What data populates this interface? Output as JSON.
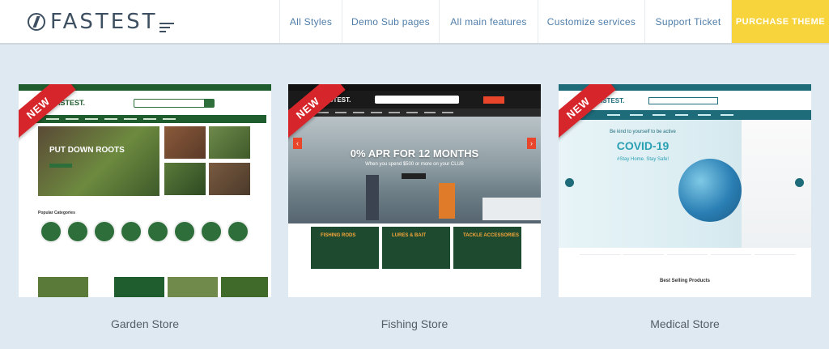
{
  "header": {
    "logo_text": "FASTEST",
    "menu": [
      {
        "label": "All Styles"
      },
      {
        "label": "Demo Sub pages"
      },
      {
        "label": "All main features"
      },
      {
        "label": "Customize services"
      },
      {
        "label": "Support Ticket"
      },
      {
        "label": "PURCHASE THEME"
      }
    ],
    "accent_color": "#f7d43b",
    "link_color": "#4f7da8"
  },
  "demos": [
    {
      "label": "Garden Store",
      "badge": "NEW",
      "preview": {
        "logo": "FASTEST.",
        "hero_title": "PUT DOWN ROOTS",
        "popular_heading": "Popular Categories"
      }
    },
    {
      "label": "Fishing Store",
      "badge": "NEW",
      "preview": {
        "logo": "FASTEST.",
        "hero_title": "0% APR FOR 12 MONTHS",
        "hero_subtitle": "When you spend $500 or more on your CLUB",
        "promo_1": "FISHING RODS",
        "promo_2": "LURES & BAIT",
        "promo_3": "TACKLE ACCESSORIES"
      }
    },
    {
      "label": "Medical Store",
      "badge": "NEW",
      "preview": {
        "logo": "FASTEST.",
        "hero_kicker": "Be kind to yourself to be active",
        "hero_title": "COVID-19",
        "hero_subtitle": "#Stay Home. Stay Safe!",
        "section_title": "Best Selling Products"
      }
    }
  ]
}
